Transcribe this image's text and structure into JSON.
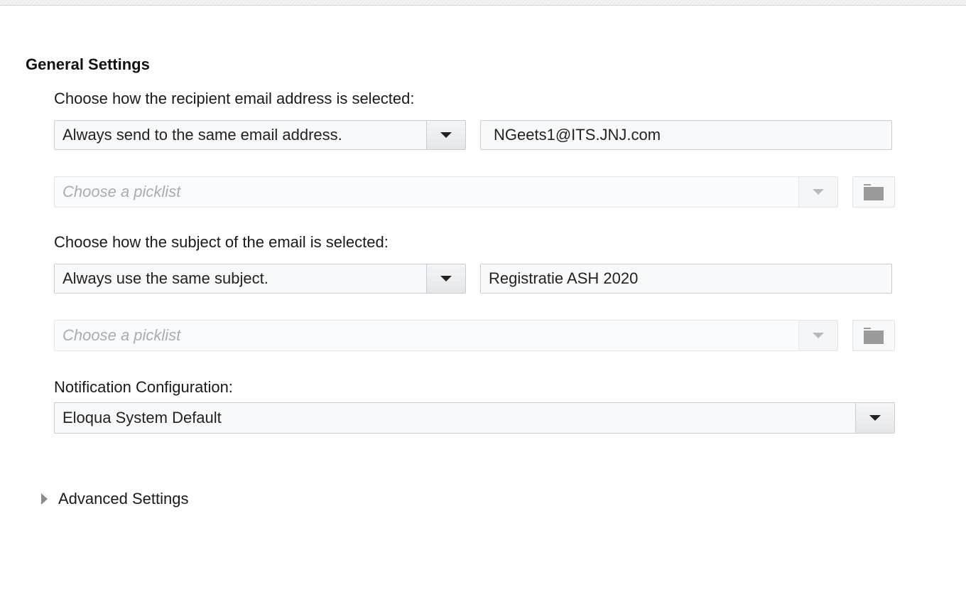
{
  "general": {
    "title": "General Settings",
    "recipient": {
      "label": "Choose how the recipient email address is selected:",
      "selected": "Always send to the same email address.",
      "value": "NGeets1@ITS.JNJ.com",
      "picklist_placeholder": "Choose a picklist"
    },
    "subject": {
      "label": "Choose how the subject of the email is selected:",
      "selected": "Always use the same subject.",
      "value": "Registratie ASH 2020",
      "picklist_placeholder": "Choose a picklist"
    },
    "notification": {
      "label": "Notification Configuration:",
      "selected": "Eloqua System Default"
    }
  },
  "advanced": {
    "label": "Advanced Settings"
  },
  "icons": {
    "dropdown": "caret-down-icon",
    "folder": "folder-icon",
    "expand": "caret-right-icon"
  },
  "colors": {
    "field_background": "#f7f9fb",
    "field_border": "#c9ccd0",
    "disabled_text": "#a9abad"
  }
}
